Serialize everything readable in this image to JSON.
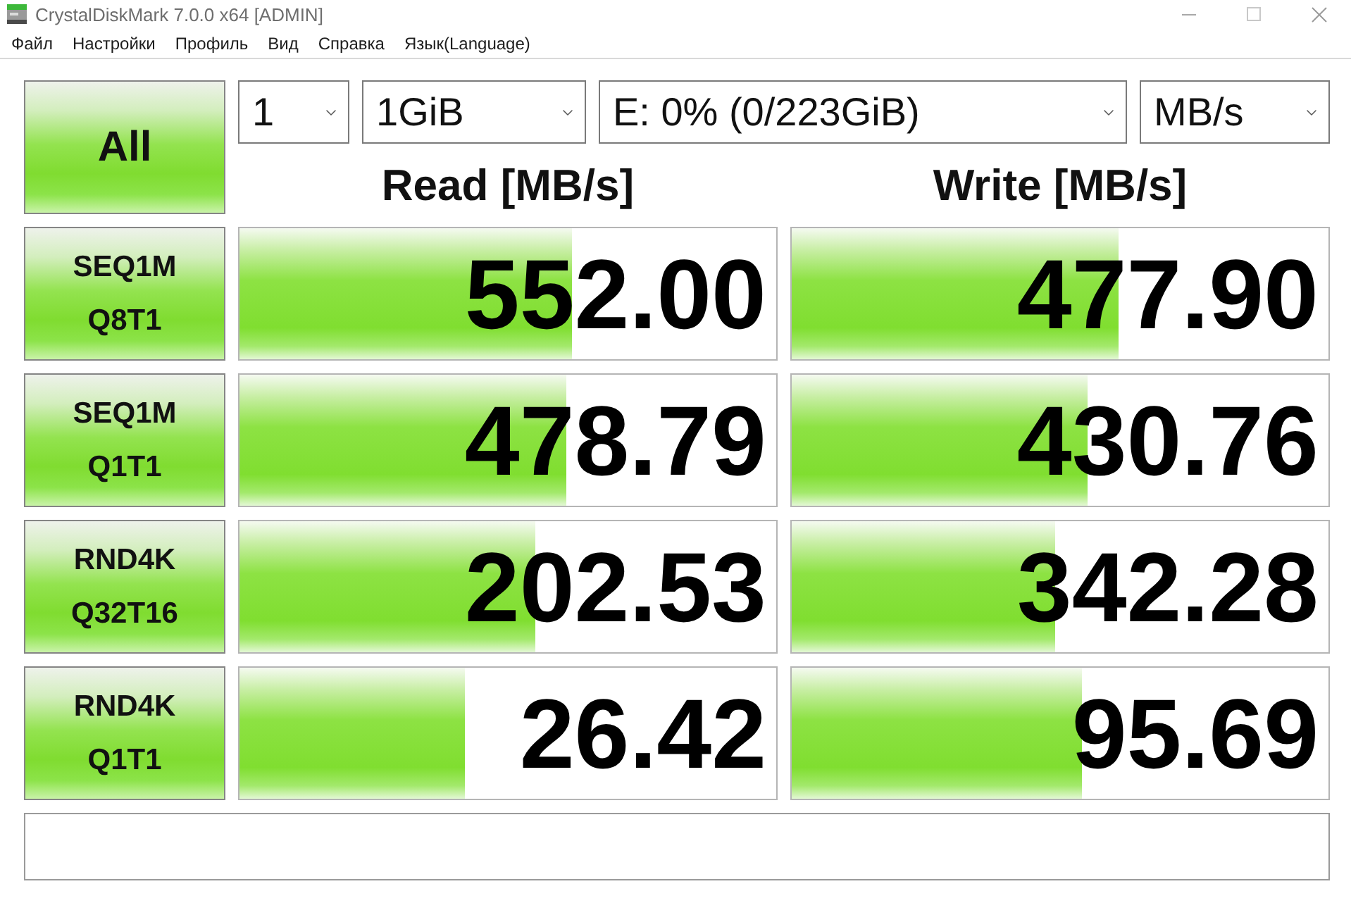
{
  "window": {
    "title": "CrystalDiskMark 7.0.0 x64 [ADMIN]"
  },
  "menu": [
    "Файл",
    "Настройки",
    "Профиль",
    "Вид",
    "Справка",
    "Язык(Language)"
  ],
  "all_button": {
    "label": "All"
  },
  "dropdowns": [
    {
      "value": "1"
    },
    {
      "value": "1GiB"
    },
    {
      "value": "E: 0% (0/223GiB)"
    },
    {
      "value": "MB/s"
    }
  ],
  "columns": [
    "Read [MB/s]",
    "Write [MB/s]"
  ],
  "tests": [
    {
      "label": [
        "SEQ1M",
        "Q8T1"
      ],
      "results": [
        {
          "value": "552.00",
          "level": 0.62
        },
        {
          "value": "477.90",
          "level": 0.61
        }
      ]
    },
    {
      "label": [
        "SEQ1M",
        "Q1T1"
      ],
      "results": [
        {
          "value": "478.79",
          "level": 0.61
        },
        {
          "value": "430.76",
          "level": 0.55
        }
      ]
    },
    {
      "label": [
        "RND4K",
        "Q32T16"
      ],
      "results": [
        {
          "value": "202.53",
          "level": 0.55
        },
        {
          "value": "342.28",
          "level": 0.49
        }
      ]
    },
    {
      "label": [
        "RND4K",
        "Q1T1"
      ],
      "results": [
        {
          "value": "26.42",
          "level": 0.42
        },
        {
          "value": "95.69",
          "level": 0.54
        }
      ]
    }
  ]
}
